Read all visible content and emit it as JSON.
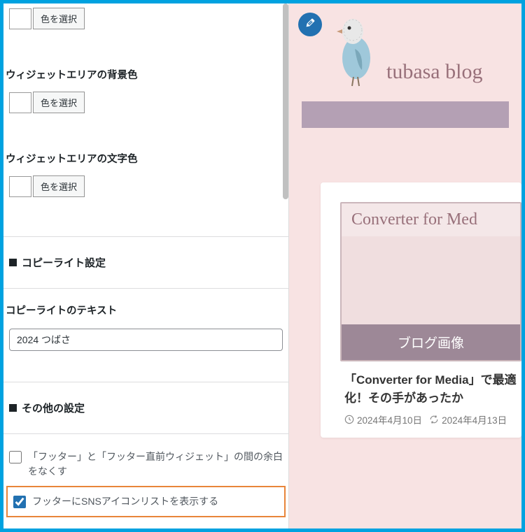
{
  "sidebar": {
    "color_button_label": "色を選択",
    "widget_bg_label": "ウィジェットエリアの背景色",
    "widget_text_label": "ウィジェットエリアの文字色",
    "copyright_section": "コピーライト設定",
    "copyright_text_label": "コピーライトのテキスト",
    "copyright_value": "2024 つばさ",
    "other_section": "その他の設定",
    "checkbox1_label": "「フッター」と「フッター直前ウィジェット」の間の余白をなくす",
    "checkbox2_label": "フッターにSNSアイコンリストを表示する",
    "checkbox1_checked": false,
    "checkbox2_checked": true
  },
  "preview": {
    "blog_title": "tubasa blog",
    "card_hero_title": "Converter for Med",
    "card_hero_footer": "ブログ画像",
    "card_headline": "「Converter for Media」で最適化！その手があったか",
    "date_created": "2024年4月10日",
    "date_updated": "2024年4月13日"
  },
  "colors": {
    "accent": "#2271b1",
    "highlight": "#e8853a",
    "preview_bg": "#f8e3e3",
    "brand_text": "#98707a"
  }
}
